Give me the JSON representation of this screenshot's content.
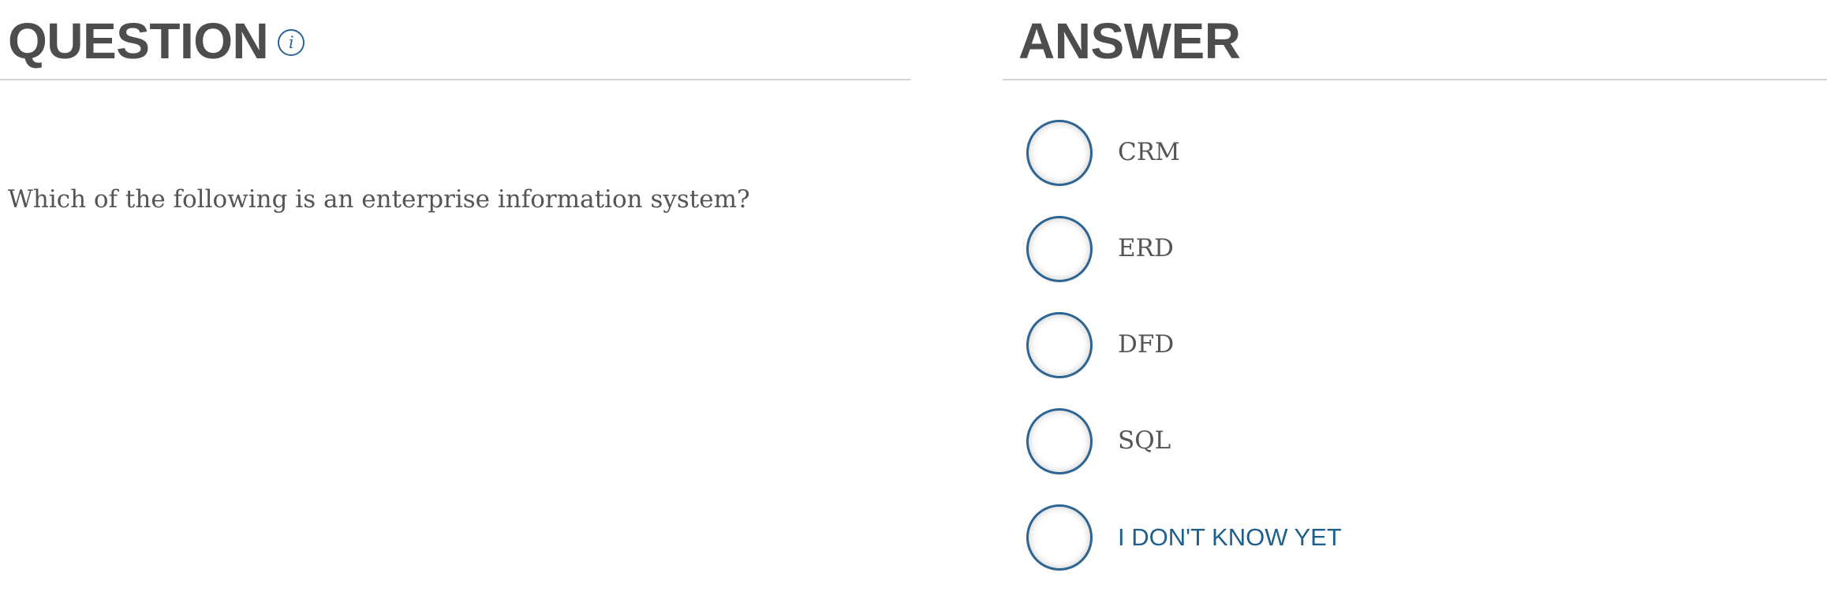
{
  "question_panel": {
    "title": "QUESTION",
    "info_icon": "info-icon",
    "question_text": "Which of the following is an enterprise information system?"
  },
  "answer_panel": {
    "title": "ANSWER",
    "options": [
      {
        "label": "CRM",
        "selected": false
      },
      {
        "label": "ERD",
        "selected": false
      },
      {
        "label": "DFD",
        "selected": false
      },
      {
        "label": "SQL",
        "selected": false
      },
      {
        "label": "I DON'T KNOW YET",
        "selected": false
      }
    ]
  },
  "colors": {
    "title_text": "#4d4d4d",
    "body_text": "#555555",
    "accent_blue": "#2c6494",
    "dont_know_text": "#1f5f8b",
    "divider": "#d6d6d6"
  }
}
